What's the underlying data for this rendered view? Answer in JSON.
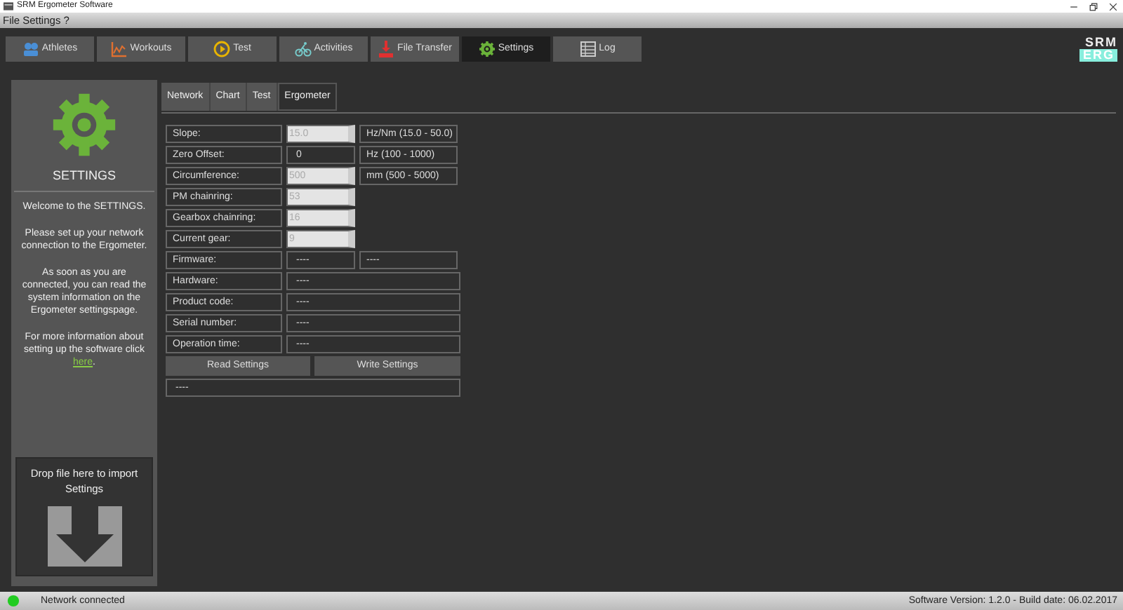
{
  "window": {
    "title": "SRM Ergometer Software"
  },
  "menu": [
    "File",
    "Settings",
    "?"
  ],
  "tabs": [
    {
      "label": "Athletes",
      "selected": false
    },
    {
      "label": "Workouts",
      "selected": false
    },
    {
      "label": "Test",
      "selected": false
    },
    {
      "label": "Activities",
      "selected": false
    },
    {
      "label": "File Transfer",
      "selected": false
    },
    {
      "label": "Settings",
      "selected": true
    },
    {
      "label": "Log",
      "selected": false
    }
  ],
  "logo": {
    "top": "SRM",
    "bottom": "ERG"
  },
  "sidebar": {
    "heading": "SETTINGS",
    "paragraphs": [
      "Welcome to the SETTINGS.",
      "Please set up your network connection to the Ergometer.",
      "As soon as you are connected, you can read the system information on the Ergometer settingspage."
    ],
    "more": {
      "before": "For more information about setting up the software click ",
      "link": "here",
      "after": "."
    },
    "drop_zone": "Drop file here to import Settings"
  },
  "subtabs": [
    {
      "label": "Network",
      "selected": false
    },
    {
      "label": "Chart",
      "selected": false
    },
    {
      "label": "Test",
      "selected": false
    },
    {
      "label": "Ergometer",
      "selected": true
    }
  ],
  "rows": [
    {
      "kind": "input",
      "label": "Slope:",
      "value": "15.0",
      "disabled": true,
      "unit": "Hz/Nm (15.0 - 50.0)"
    },
    {
      "kind": "input",
      "label": "Zero Offset:",
      "value": "0",
      "disabled": false,
      "unit": "Hz (100 - 1000)"
    },
    {
      "kind": "input",
      "label": "Circumference:",
      "value": "500",
      "disabled": true,
      "unit": "mm (500 - 5000)"
    },
    {
      "kind": "input",
      "label": "PM chainring:",
      "value": "53",
      "disabled": true
    },
    {
      "kind": "input",
      "label": "Gearbox chainring:",
      "value": "16",
      "disabled": true
    },
    {
      "kind": "input",
      "label": "Current gear:",
      "value": "9",
      "disabled": true
    },
    {
      "kind": "info",
      "label": "Firmware:",
      "values": [
        "----",
        "----"
      ]
    },
    {
      "kind": "info",
      "label": "Hardware:",
      "values": [
        "----"
      ]
    },
    {
      "kind": "info",
      "label": "Product code:",
      "values": [
        "----"
      ]
    },
    {
      "kind": "info",
      "label": "Serial number:",
      "values": [
        "----"
      ]
    },
    {
      "kind": "info",
      "label": "Operation time:",
      "values": [
        "----"
      ]
    }
  ],
  "buttons": [
    "Read Settings",
    "Write Settings"
  ],
  "message": "----",
  "status_bar": {
    "connected": true,
    "text": "Network connected",
    "version": "Software Version: 1.2.0 - Build date: 06.02.2017"
  }
}
